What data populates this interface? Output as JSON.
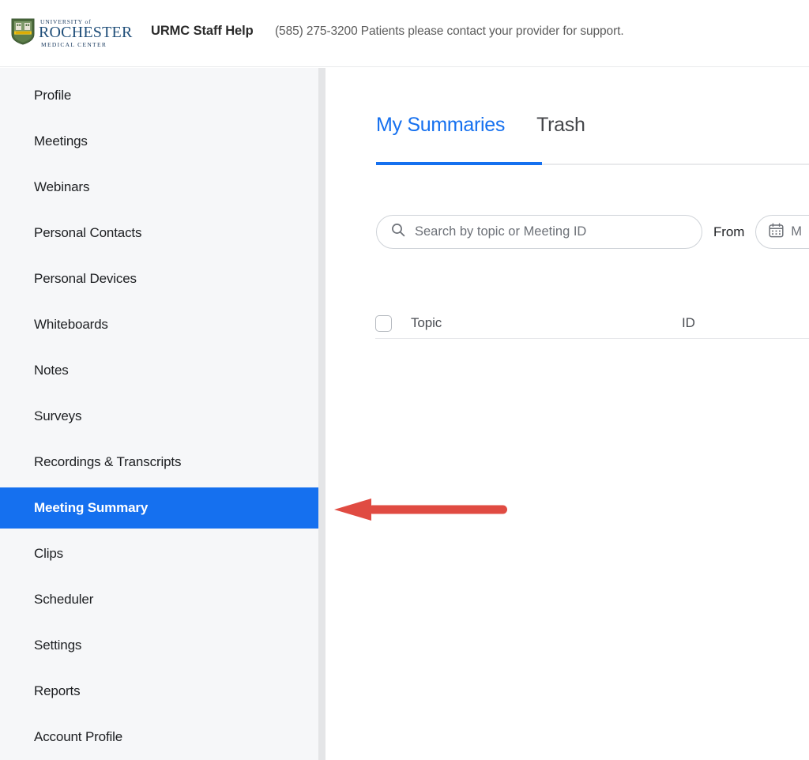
{
  "header": {
    "logo": {
      "icon": "university-shield-crest-icon",
      "line1": "UNIVERSITY of",
      "line2": "ROCHESTER",
      "line3": "MEDICAL CENTER"
    },
    "help_title": "URMC Staff Help",
    "help_note": "(585) 275-3200 Patients please contact your provider for support."
  },
  "sidebar": {
    "items": [
      {
        "label": "Profile",
        "active": false
      },
      {
        "label": "Meetings",
        "active": false
      },
      {
        "label": "Webinars",
        "active": false
      },
      {
        "label": "Personal Contacts",
        "active": false
      },
      {
        "label": "Personal Devices",
        "active": false
      },
      {
        "label": "Whiteboards",
        "active": false
      },
      {
        "label": "Notes",
        "active": false
      },
      {
        "label": "Surveys",
        "active": false
      },
      {
        "label": "Recordings & Transcripts",
        "active": false
      },
      {
        "label": "Meeting Summary",
        "active": true
      },
      {
        "label": "Clips",
        "active": false
      },
      {
        "label": "Scheduler",
        "active": false
      },
      {
        "label": "Settings",
        "active": false
      },
      {
        "label": "Reports",
        "active": false
      },
      {
        "label": "Account Profile",
        "active": false
      }
    ]
  },
  "main": {
    "tabs": [
      {
        "label": "My Summaries",
        "active": true
      },
      {
        "label": "Trash",
        "active": false
      }
    ],
    "search": {
      "icon": "search-icon",
      "placeholder": "Search by topic or Meeting ID",
      "value": ""
    },
    "date_filter": {
      "from_label": "From",
      "calendar_icon": "calendar-icon",
      "value": "M"
    },
    "table": {
      "columns": [
        {
          "label": "Topic"
        },
        {
          "label": "ID"
        }
      ],
      "rows": []
    }
  },
  "annotation": {
    "arrow": {
      "icon": "left-arrow-annotation-icon",
      "color": "#e04b42",
      "direction": "left",
      "points_to": "Meeting Summary"
    }
  },
  "colors": {
    "accent_blue": "#1570ef",
    "sidebar_bg": "#f6f7f9",
    "annotation_red": "#e04b42",
    "text_primary": "#1c1e21",
    "text_muted": "#6d7178"
  }
}
